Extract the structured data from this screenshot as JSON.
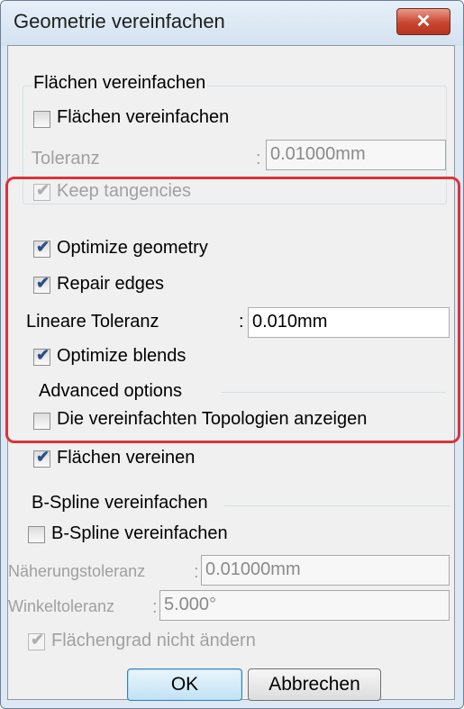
{
  "window": {
    "title": "Geometrie vereinfachen"
  },
  "sec1": {
    "legend": "Flächen vereinfachen",
    "simplify_label": "Flächen vereinfachen",
    "simplify_checked": false,
    "tolerance_label": "Toleranz",
    "tolerance_value": "0.01000mm",
    "tangencies_label": "Keep tangencies",
    "tangencies_checked": true
  },
  "sec2": {
    "optimize_geometry_label": "Optimize geometry",
    "optimize_geometry_checked": true,
    "repair_edges_label": "Repair edges",
    "repair_edges_checked": true,
    "linear_tolerance_label": "Lineare Toleranz",
    "linear_tolerance_value": "0.010mm",
    "optimize_blends_label": "Optimize blends",
    "optimize_blends_checked": true,
    "advanced_legend": "Advanced options",
    "show_topologies_label": "Die vereinfachten Topologien anzeigen",
    "show_topologies_checked": false,
    "merge_faces_label": "Flächen vereinen",
    "merge_faces_checked": true
  },
  "sec3": {
    "legend": "B-Spline vereinfachen",
    "simplify_label": "B-Spline vereinfachen",
    "simplify_checked": false,
    "approx_label": "Näherungstoleranz",
    "approx_value": "0.01000mm",
    "angle_label": "Winkeltoleranz",
    "angle_value": "5.000°",
    "degree_label": "Flächengrad nicht ändern",
    "degree_checked": true
  },
  "buttons": {
    "ok": "OK",
    "cancel": "Abbrechen"
  },
  "colors": {
    "highlight": "#d9343a",
    "close": "#c8452f"
  }
}
